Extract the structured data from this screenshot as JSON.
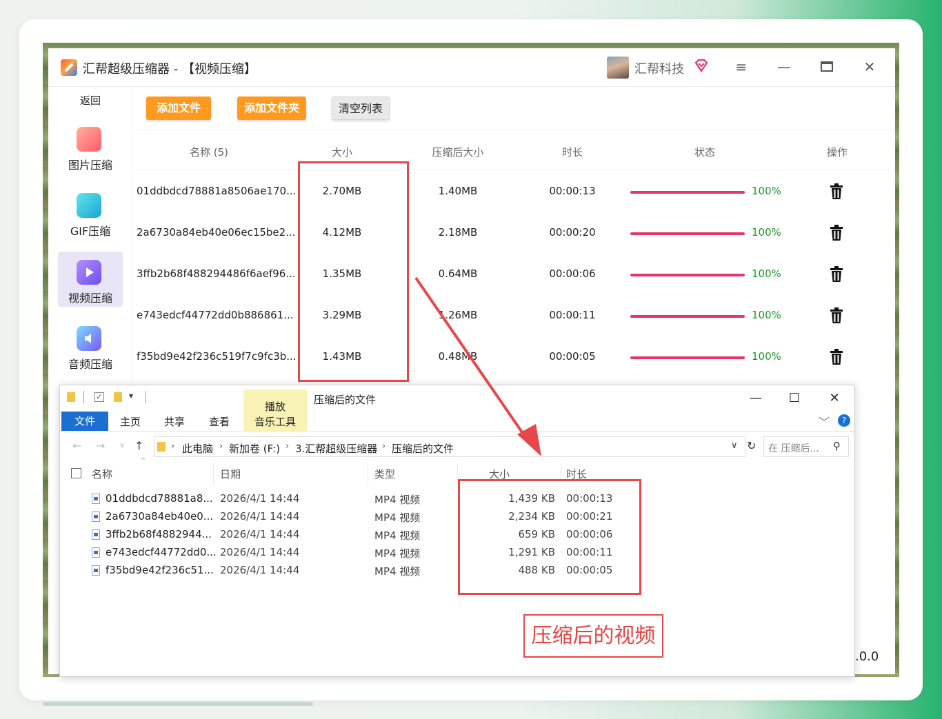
{
  "app": {
    "title": "汇帮超级压缩器  - 【视频压缩】",
    "company": "汇帮科技",
    "menu_icon": "hamburger-icon",
    "minimize_icon": "minimize-icon",
    "maximize_icon": "maximize-icon",
    "close_icon": "close-icon"
  },
  "sidebar": {
    "back": "返回",
    "items": [
      {
        "label": "图片压缩",
        "icon": "image-compress-icon",
        "color": "#ff6f6f"
      },
      {
        "label": "GIF压缩",
        "icon": "gif-compress-icon",
        "color": "#1ac2d8"
      },
      {
        "label": "视频压缩",
        "icon": "video-compress-icon",
        "color": "#7a5cf0",
        "active": true
      },
      {
        "label": "音频压缩",
        "icon": "audio-compress-icon",
        "color": "#4ab8ff"
      }
    ]
  },
  "toolbar": {
    "add_file": "添加文件",
    "add_folder": "添加文件夹",
    "clear_list": "清空列表"
  },
  "table": {
    "headers": {
      "name": "名称 (5)",
      "size": "大小",
      "compressed": "压缩后大小",
      "duration": "时长",
      "status": "状态",
      "action": "操作"
    },
    "rows": [
      {
        "name": "01ddbdcd78881a8506ae170...",
        "size": "2.70MB",
        "compressed": "1.40MB",
        "duration": "00:00:13",
        "progress": 100,
        "percent": "100%"
      },
      {
        "name": "2a6730a84eb40e06ec15be2...",
        "size": "4.12MB",
        "compressed": "2.18MB",
        "duration": "00:00:20",
        "progress": 100,
        "percent": "100%"
      },
      {
        "name": "3ffb2b68f488294486f6aef96...",
        "size": "1.35MB",
        "compressed": "0.64MB",
        "duration": "00:00:06",
        "progress": 100,
        "percent": "100%"
      },
      {
        "name": "e743edcf44772dd0b886861...",
        "size": "3.29MB",
        "compressed": "1.26MB",
        "duration": "00:00:11",
        "progress": 100,
        "percent": "100%"
      },
      {
        "name": "f35bd9e42f236c519f7c9fc3b...",
        "size": "1.43MB",
        "compressed": "0.48MB",
        "duration": "00:00:05",
        "progress": 100,
        "percent": "100%"
      }
    ]
  },
  "explorer": {
    "title": "压缩后的文件",
    "context_tab": "播放",
    "ribbon_tabs": [
      "文件",
      "主页",
      "共享",
      "查看",
      "音乐工具"
    ],
    "breadcrumb": [
      "此电脑",
      "新加卷 (F:)",
      "3.汇帮超级压缩器",
      "压缩后的文件"
    ],
    "search_placeholder": "在 压缩后...",
    "headers": {
      "name": "名称",
      "date": "日期",
      "type": "类型",
      "size": "大小",
      "duration": "时长"
    },
    "files": [
      {
        "name": "01ddbdcd78881a8...",
        "date": "2026/4/1 14:44",
        "type": "MP4 视频",
        "size": "1,439 KB",
        "duration": "00:00:13"
      },
      {
        "name": "2a6730a84eb40e0...",
        "date": "2026/4/1 14:44",
        "type": "MP4 视频",
        "size": "2,234 KB",
        "duration": "00:00:21"
      },
      {
        "name": "3ffb2b68f4882944...",
        "date": "2026/4/1 14:44",
        "type": "MP4 视频",
        "size": "659 KB",
        "duration": "00:00:06"
      },
      {
        "name": "e743edcf44772dd0...",
        "date": "2026/4/1 14:44",
        "type": "MP4 视频",
        "size": "1,291 KB",
        "duration": "00:00:11"
      },
      {
        "name": "f35bd9e42f236c51...",
        "date": "2026/4/1 14:44",
        "type": "MP4 视频",
        "size": "488 KB",
        "duration": "00:00:05"
      }
    ]
  },
  "annotation": {
    "label": "压缩后的视频",
    "color": "#e8474a"
  },
  "version_fragment": ".0.0",
  "colors": {
    "accent_orange": "#ff9a1e",
    "progress": "#e8336b",
    "percent_green": "#1c9a2a",
    "ribbon_blue": "#1b6fd0"
  }
}
